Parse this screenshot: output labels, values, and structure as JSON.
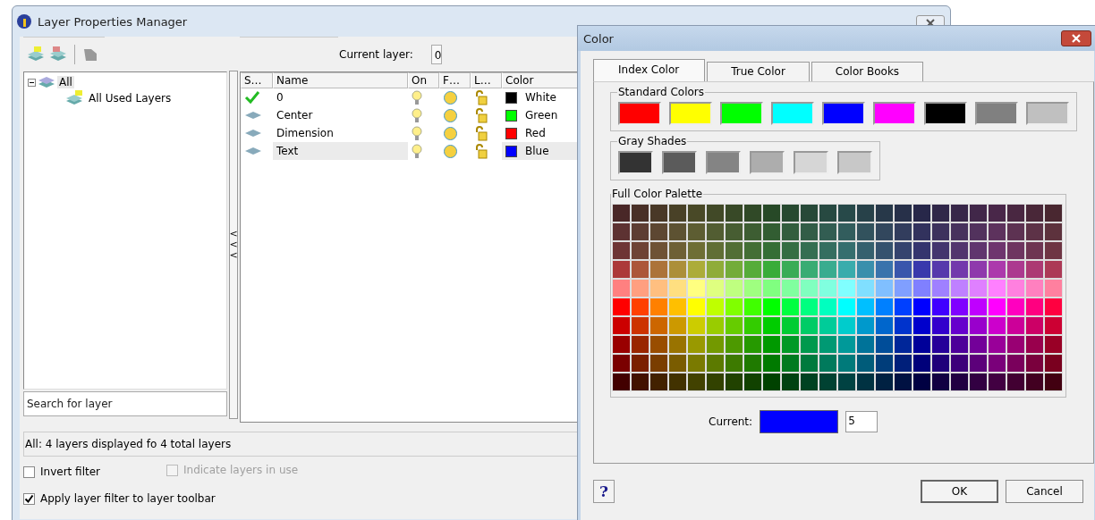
{
  "layer_window": {
    "title": "Layer Properties Manager",
    "current_layer_label": "Current layer:",
    "current_layer": "0",
    "filter_tree": [
      {
        "label": "All",
        "selected": true,
        "expanded": true,
        "children": [
          {
            "label": "All Used Layers",
            "selected": false
          }
        ]
      }
    ],
    "search": {
      "placeholder": "Search for layer"
    },
    "splitter_arrows": [
      "<",
      "<",
      "<"
    ],
    "table": {
      "columns": [
        "S…",
        "Name",
        "On",
        "F…",
        "L…",
        "Color"
      ],
      "rows": [
        {
          "current": true,
          "name": "0",
          "color": "#000000",
          "color_name": "White",
          "selected": false
        },
        {
          "current": false,
          "name": "Center",
          "color": "#00ff00",
          "color_name": "Green",
          "selected": false
        },
        {
          "current": false,
          "name": "Dimension",
          "color": "#ff0000",
          "color_name": "Red",
          "selected": false
        },
        {
          "current": false,
          "name": "Text",
          "color": "#0000ff",
          "color_name": "Blue",
          "selected": true
        }
      ]
    },
    "status_text": "All: 4 layers displayed fo 4 total layers",
    "checkboxes": [
      {
        "label": "Invert filter",
        "checked": false,
        "disabled": false
      },
      {
        "label": "Indicate layers in use",
        "checked": false,
        "disabled": true
      },
      {
        "label": "Apply layer filter to layer toolbar",
        "checked": true,
        "disabled": false
      }
    ]
  },
  "color_dialog": {
    "title": "Color",
    "tabs": [
      {
        "label": "Index Color",
        "selected": true
      },
      {
        "label": "True Color",
        "selected": false
      },
      {
        "label": "Color Books",
        "selected": false
      }
    ],
    "standard_colors": {
      "title": "Standard Colors",
      "swatches": [
        {
          "color": "#ff0000"
        },
        {
          "color": "#ffff00"
        },
        {
          "color": "#00ff00"
        },
        {
          "color": "#00ffff"
        },
        {
          "color": "#0000ff"
        },
        {
          "color": "#ff00ff"
        },
        {
          "color": "#000000"
        },
        {
          "color": "#808080"
        },
        {
          "color": "#c0c0c0"
        }
      ]
    },
    "gray_shades": {
      "title": "Gray Shades",
      "swatches": [
        {
          "color": "#333333"
        },
        {
          "color": "#5b5b5b"
        },
        {
          "color": "#848484"
        },
        {
          "color": "#adadad"
        },
        {
          "color": "#d6d6d6"
        },
        {
          "color": "#c8c8c8"
        }
      ]
    },
    "palette_title": "Full Color Palette",
    "current_label": "Current:",
    "current_swatch": {
      "color": "#0000ff"
    },
    "current_index": "5",
    "help": "?",
    "buttons": [
      "OK",
      "Cancel"
    ]
  }
}
